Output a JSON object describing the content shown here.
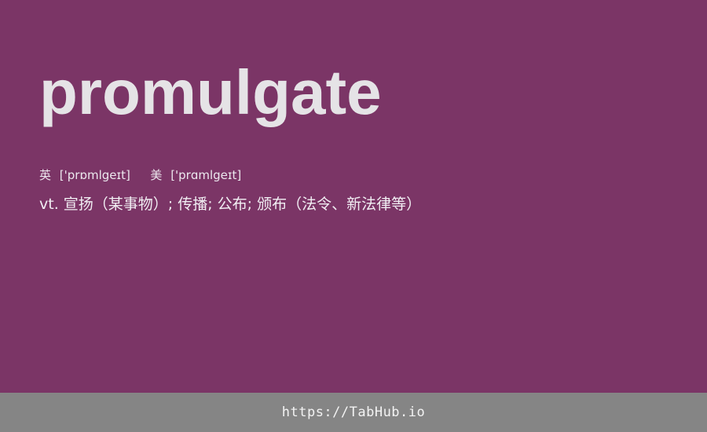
{
  "card": {
    "word": "promulgate",
    "phonetic": {
      "uk_label": "英",
      "uk_ipa": "['prɒmlgeɪt]",
      "us_label": "美",
      "us_ipa": "['prɑmlgeɪt]"
    },
    "definition": "vt. 宣扬（某事物）; 传播; 公布; 颁布（法令、新法律等）"
  },
  "footer": {
    "link_text": "https://TabHub.io"
  },
  "colors": {
    "background": "#7b3566",
    "footer_background": "#858585",
    "word_color": "#e5e3e6"
  }
}
